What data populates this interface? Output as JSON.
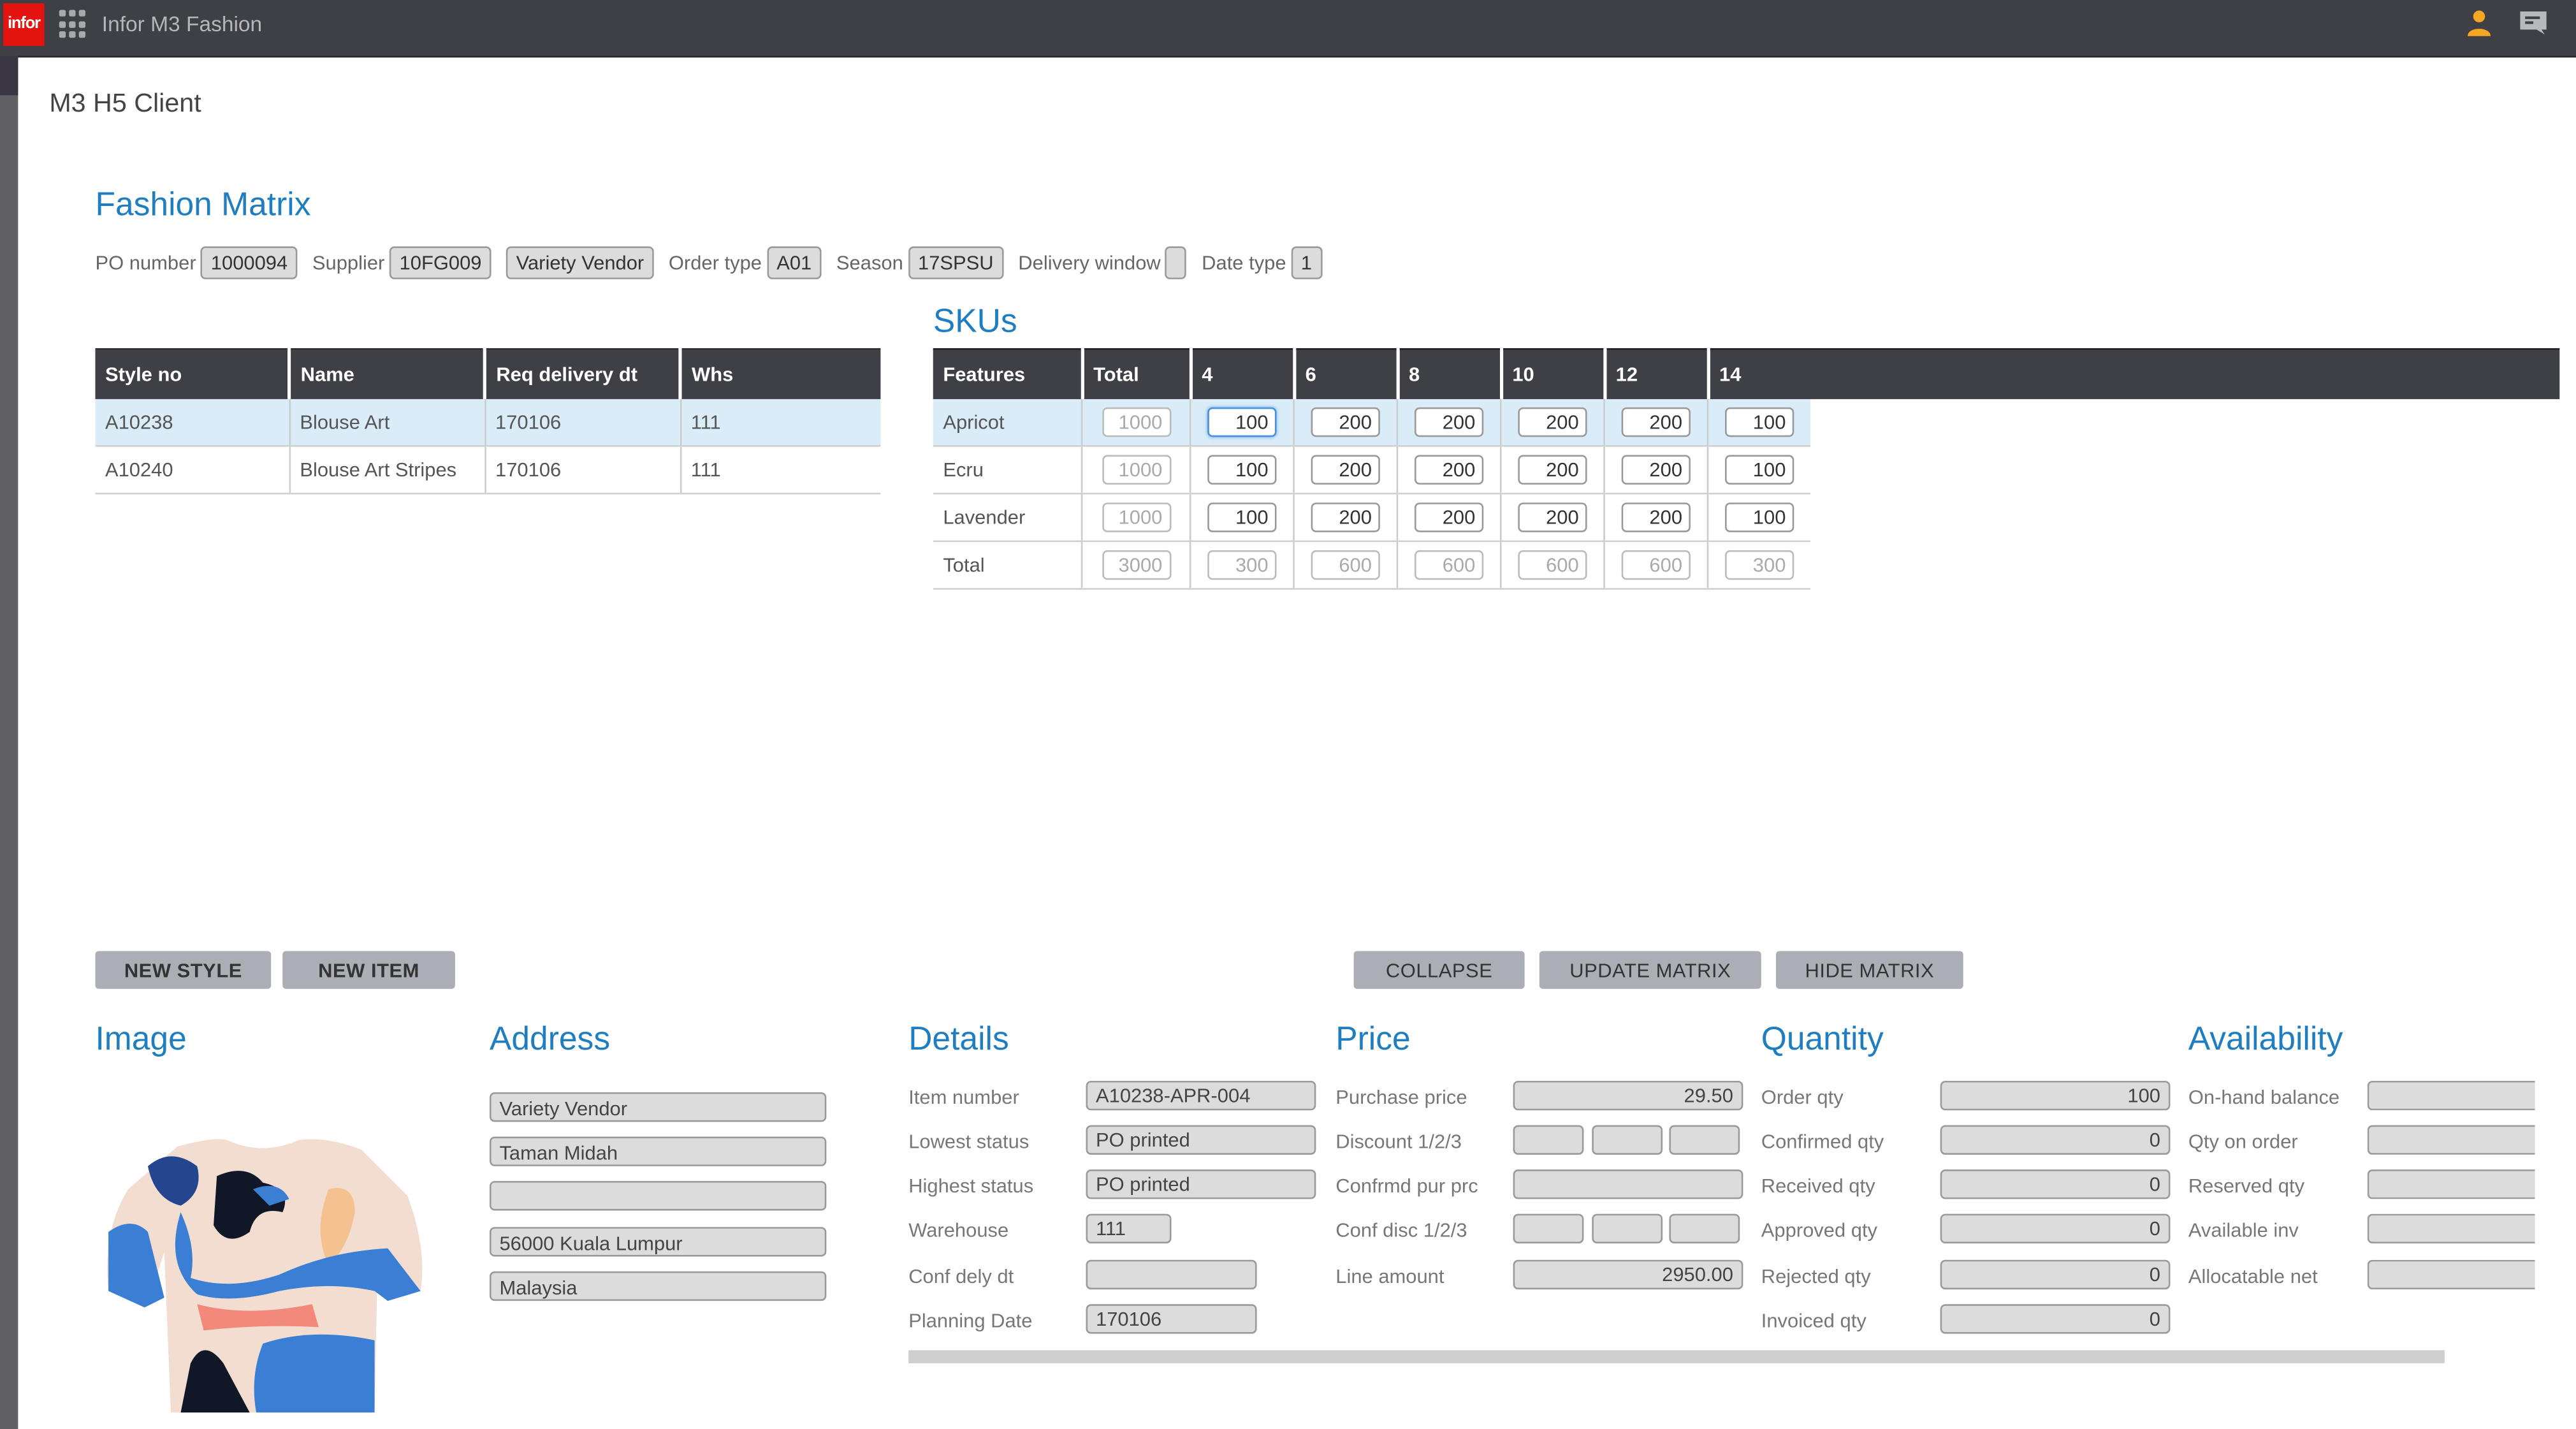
{
  "topbar": {
    "logo_text": "infor",
    "app_title": "Infor M3 Fashion",
    "icons": [
      "apps-grid-icon",
      "user-icon",
      "chat-icon"
    ]
  },
  "client_title": "M3 H5 Client",
  "fashion_matrix": {
    "title": "Fashion Matrix",
    "filters": [
      {
        "label": "PO number",
        "value": "1000094"
      },
      {
        "label": "Supplier",
        "value": "10FG009"
      },
      {
        "label": "",
        "value": "Variety Vendor"
      },
      {
        "label": "Order type",
        "value": "A01"
      },
      {
        "label": "Season",
        "value": "17SPSU"
      },
      {
        "label": "Delivery window",
        "value": ""
      },
      {
        "label": "Date type",
        "value": "1"
      }
    ]
  },
  "styles_table": {
    "columns": [
      "Style no",
      "Name",
      "Req delivery dt",
      "Whs"
    ],
    "rows": [
      [
        "A10238",
        "Blouse Art",
        "170106",
        "111"
      ],
      [
        "A10240",
        "Blouse Art Stripes",
        "170106",
        "111"
      ]
    ],
    "selected_row": 0
  },
  "skus": {
    "title": "SKUs",
    "columns": [
      "Features",
      "Total",
      "4",
      "6",
      "8",
      "10",
      "12",
      "14"
    ],
    "rows": [
      {
        "feature": "Apricot",
        "total": "1000",
        "sizes": [
          "100",
          "200",
          "200",
          "200",
          "200",
          "100"
        ]
      },
      {
        "feature": "Ecru",
        "total": "1000",
        "sizes": [
          "100",
          "200",
          "200",
          "200",
          "200",
          "100"
        ]
      },
      {
        "feature": "Lavender",
        "total": "1000",
        "sizes": [
          "100",
          "200",
          "200",
          "200",
          "200",
          "100"
        ]
      },
      {
        "feature": "Total",
        "total": "3000",
        "sizes": [
          "300",
          "600",
          "600",
          "600",
          "600",
          "300"
        ]
      }
    ],
    "selected_row": 0,
    "focused_cell": {
      "row": 0,
      "size": "4"
    }
  },
  "buttons": {
    "new_style": "NEW STYLE",
    "new_item": "NEW ITEM",
    "collapse": "COLLAPSE",
    "update_matrix": "UPDATE MATRIX",
    "hide_matrix": "HIDE MATRIX"
  },
  "image_section": {
    "title": "Image",
    "alt": "Blouse Art (Apricot) product image"
  },
  "address": {
    "title": "Address",
    "lines": [
      "Variety Vendor",
      "Taman Midah",
      "",
      "56000 Kuala Lumpur",
      "Malaysia"
    ]
  },
  "details": {
    "title": "Details",
    "fields": [
      {
        "label": "Item number",
        "value": "A10238-APR-004"
      },
      {
        "label": "Lowest status",
        "value": "PO printed"
      },
      {
        "label": "Highest status",
        "value": "PO printed"
      },
      {
        "label": "Warehouse",
        "value": "111"
      },
      {
        "label": "Conf dely dt",
        "value": ""
      },
      {
        "label": "Planning Date",
        "value": "170106"
      }
    ]
  },
  "price": {
    "title": "Price",
    "fields": [
      {
        "label": "Purchase price",
        "value": "29.50"
      },
      {
        "label": "Discount 1/2/3",
        "values": [
          "",
          "",
          ""
        ]
      },
      {
        "label": "Confrmd pur prc",
        "value": ""
      },
      {
        "label": "Conf disc 1/2/3",
        "values": [
          "",
          "",
          ""
        ]
      },
      {
        "label": "Line amount",
        "value": "2950.00"
      }
    ]
  },
  "quantity": {
    "title": "Quantity",
    "fields": [
      {
        "label": "Order qty",
        "value": "100"
      },
      {
        "label": "Confirmed qty",
        "value": "0"
      },
      {
        "label": "Received qty",
        "value": "0"
      },
      {
        "label": "Approved qty",
        "value": "0"
      },
      {
        "label": "Rejected qty",
        "value": "0"
      },
      {
        "label": "Invoiced qty",
        "value": "0"
      }
    ]
  },
  "availability": {
    "title": "Availability",
    "fields": [
      {
        "label": "On-hand balance",
        "value": ""
      },
      {
        "label": "Qty on order",
        "value": ""
      },
      {
        "label": "Reserved qty",
        "value": ""
      },
      {
        "label": "Available inv",
        "value": ""
      },
      {
        "label": "Allocatable net",
        "value": ""
      }
    ]
  },
  "colors": {
    "accent_blue": "#1f7ec1",
    "topbar": "#3f4046",
    "logo_red": "#e3130f",
    "selected_row": "#d9ecf7",
    "user_icon": "#f5a623"
  }
}
